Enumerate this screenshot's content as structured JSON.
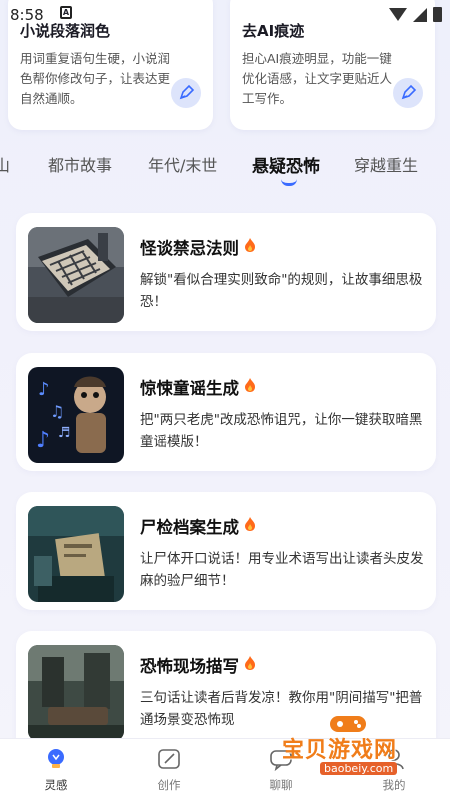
{
  "status_bar": {
    "time": "8:58"
  },
  "tool_cards": [
    {
      "title": "小说段落润色",
      "desc": "用词重复语句生硬，小说润色帮你修改句子，让表达更自然通顺。"
    },
    {
      "title": "去AI痕迹",
      "desc": "担心AI痕迹明显，功能一键优化语感，让文字更贴近人工写作。"
    }
  ],
  "tabs": [
    "山",
    "都市故事",
    "年代/末世",
    "悬疑恐怖",
    "穿越重生"
  ],
  "active_tab": "悬疑恐怖",
  "cards": [
    {
      "title": "怪谈禁忌法则",
      "desc": "解锁\"看似合理实则致命\"的规则，让故事细思极恐！"
    },
    {
      "title": "惊悚童谣生成",
      "desc": "把\"两只老虎\"改成恐怖诅咒，让你一键获取暗黑童谣模版！"
    },
    {
      "title": "尸检档案生成",
      "desc": "让尸体开口说话！用专业术语写出让读者头皮发麻的验尸细节！"
    },
    {
      "title": "恐怖现场描写",
      "desc": "三句话让读者后背发凉！教你用\"阴间描写\"把普通场景变恐怖现"
    }
  ],
  "watermark": {
    "text": "宝贝游戏网",
    "url": "baobeiy.com"
  },
  "nav": [
    {
      "label": "灵感"
    },
    {
      "label": "创作"
    },
    {
      "label": "聊聊"
    },
    {
      "label": "我的"
    }
  ],
  "colors": {
    "accent": "#3a6bff",
    "flame": "#ff6a1a",
    "card_bg": "#ffffff",
    "page_bg": "#eef0fb"
  }
}
